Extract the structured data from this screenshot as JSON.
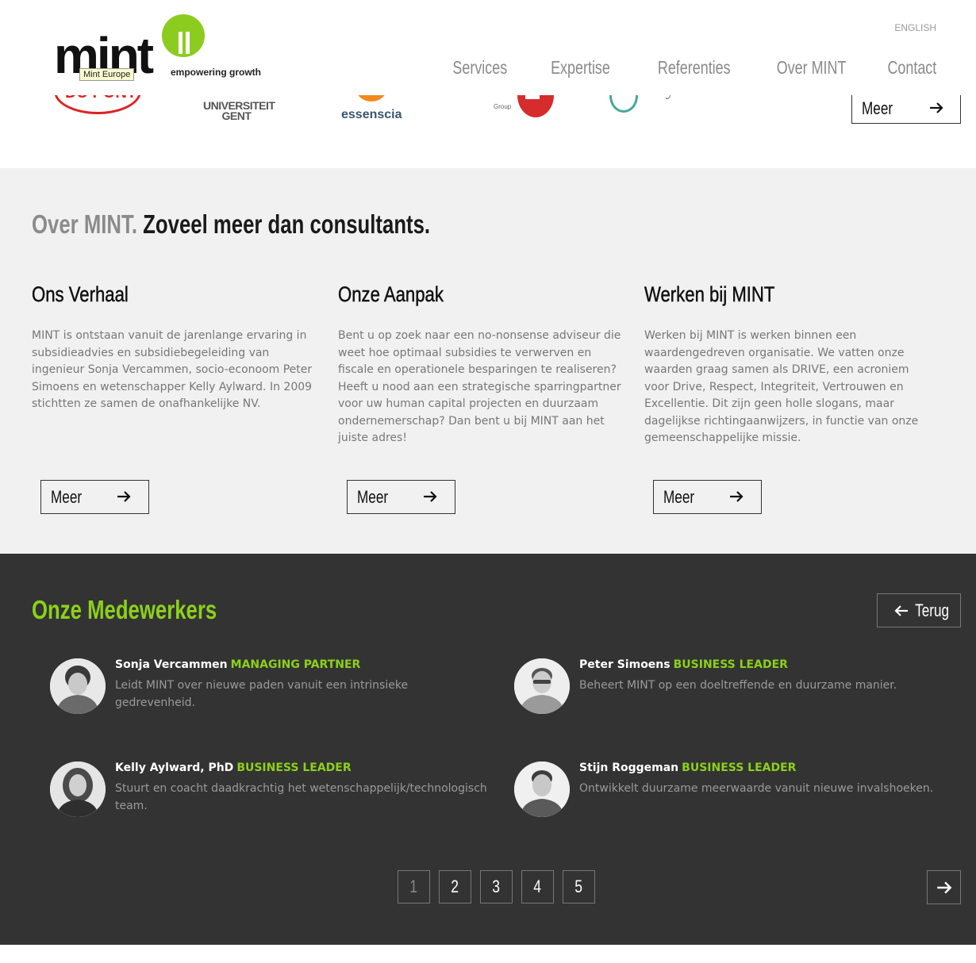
{
  "header": {
    "logo": {
      "wordmark": "mint",
      "tagline": "empowering growth",
      "tooltip": "Mint Europe"
    },
    "language": "ENGLISH",
    "nav": [
      "Services",
      "Expertise",
      "Referenties",
      "Over MINT",
      "Contact"
    ]
  },
  "clients": {
    "logos": [
      "DU PONT",
      "UNIVERSITEIT GENT",
      "essenscia",
      "Group",
      "Bayer"
    ],
    "more_label": "Meer"
  },
  "about": {
    "title_light": "Over MINT.",
    "title_dark": "Zoveel meer dan consultants.",
    "columns": [
      {
        "heading": "Ons Verhaal",
        "text": "MINT is ontstaan vanuit de jarenlange ervaring in subsidieadvies en subsidiebegeleiding van ingenieur Sonja Vercammen, socio-econoom Peter Simoens en wetenschapper Kelly Aylward. In 2009 stichtten ze samen de onafhankelijke NV.",
        "button": "Meer"
      },
      {
        "heading": "Onze Aanpak",
        "text": "Bent u op zoek naar een no-nonsense adviseur die weet hoe optimaal subsidies te verwerven en fiscale en operationele besparingen te realiseren? Heeft u nood aan een strategische sparringpartner voor uw human capital projecten en duurzaam ondernemerschap? Dan bent u bij MINT aan het juiste adres!",
        "button": "Meer"
      },
      {
        "heading": "Werken bij MINT",
        "text": "Werken bij MINT is werken binnen een waardengedreven organisatie. We vatten onze waarden graag samen als DRIVE, een acroniem voor Drive, Respect, Integriteit, Vertrouwen en Excellentie. Dit zijn geen holle slogans, maar dagelijkse richtingaanwijzers, in functie van onze gemeenschappelijke missie.",
        "button": "Meer"
      }
    ]
  },
  "team": {
    "title": "Onze Medewerkers",
    "back_label": "Terug",
    "members": [
      {
        "name": "Sonja Vercammen",
        "role": "MANAGING PARTNER",
        "desc": "Leidt MINT over nieuwe paden vanuit een intrinsieke gedrevenheid."
      },
      {
        "name": "Peter Simoens",
        "role": "BUSINESS LEADER",
        "desc": "Beheert MINT op een doeltreffende en duurzame manier."
      },
      {
        "name": "Kelly Aylward, PhD",
        "role": "BUSINESS LEADER",
        "desc": "Stuurt en coacht daadkrachtig het wetenschappelijk/technologisch team."
      },
      {
        "name": "Stijn Roggeman",
        "role": "BUSINESS LEADER",
        "desc": "Ontwikkelt duurzame meerwaarde vanuit nieuwe invalshoeken."
      }
    ],
    "pages": [
      "1",
      "2",
      "3",
      "4",
      "5"
    ],
    "active_page": "1"
  },
  "colors": {
    "accent": "#8cd11a",
    "dark_bg": "#333333",
    "light_bg": "#f1f1f1"
  }
}
